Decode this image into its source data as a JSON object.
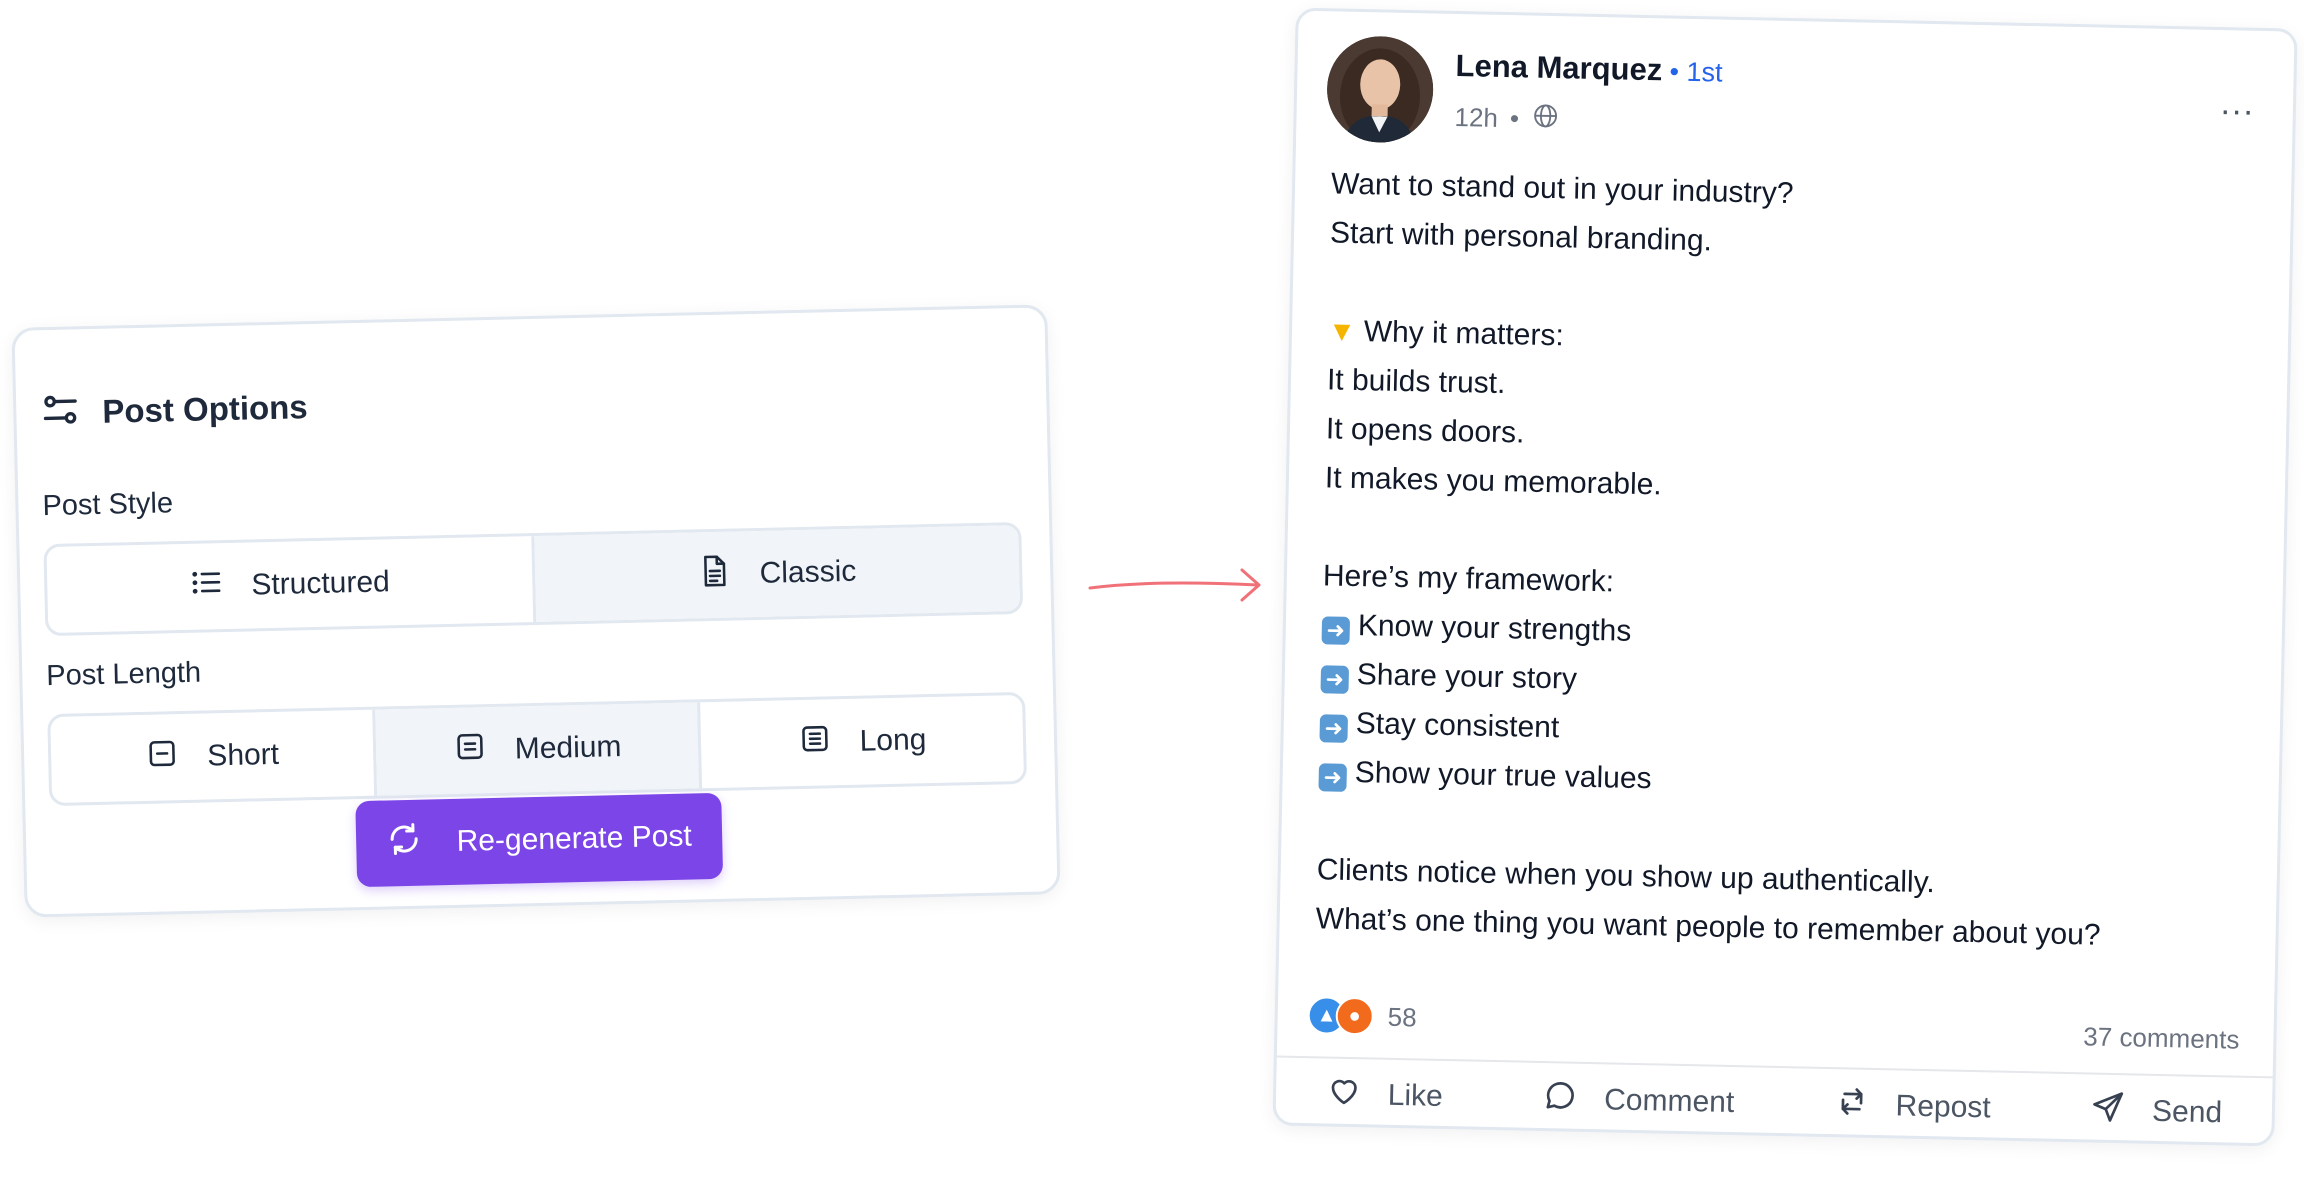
{
  "options": {
    "title": "Post Options",
    "style_label": "Post Style",
    "styles": [
      {
        "label": "Structured",
        "icon": "list-icon",
        "selected": false
      },
      {
        "label": "Classic",
        "icon": "document-icon",
        "selected": true
      }
    ],
    "length_label": "Post Length",
    "lengths": [
      {
        "label": "Short",
        "icon": "minus-square-icon",
        "selected": false
      },
      {
        "label": "Medium",
        "icon": "medium-lines-icon",
        "selected": true
      },
      {
        "label": "Long",
        "icon": "long-lines-icon",
        "selected": false
      }
    ],
    "regenerate_label": "Re-generate Post",
    "accent_color": "#7c45e8"
  },
  "post": {
    "author": "Lena Marquez",
    "degree": "• 1st",
    "time": "12h",
    "dot": "•",
    "more": "...",
    "lines": [
      "Want to stand out in your industry?",
      "Start with personal branding.",
      "",
      "Why it matters:",
      "It builds trust.",
      "It opens doors.",
      "It makes you memorable.",
      "",
      "Here’s my framework:",
      "Know your strengths",
      "Share your story",
      "Stay consistent",
      "Show your true values",
      "",
      "Clients notice when you show up authentically.",
      "What’s one thing you want people to remember about you?"
    ],
    "reaction_count": "58",
    "comments": "37 comments",
    "actions": {
      "like": "Like",
      "comment": "Comment",
      "repost": "Repost",
      "send": "Send"
    }
  }
}
